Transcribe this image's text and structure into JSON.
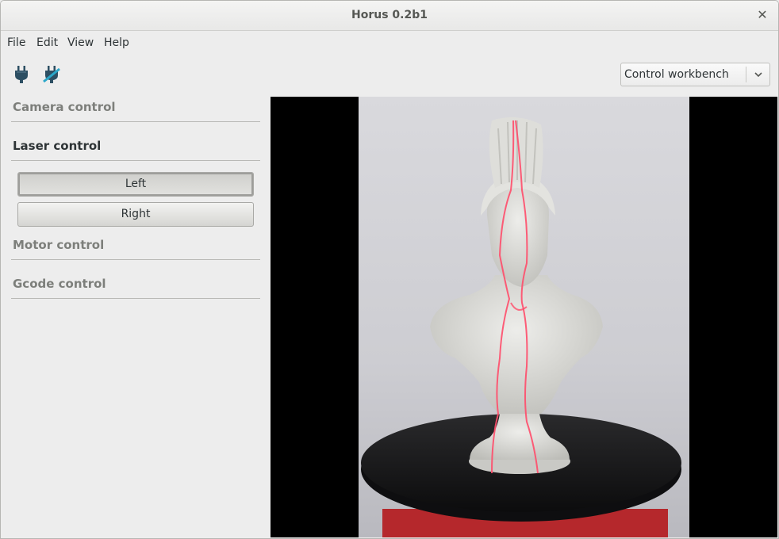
{
  "window": {
    "title": "Horus 0.2b1"
  },
  "menu": [
    "File",
    "Edit",
    "View",
    "Help"
  ],
  "toolbar": {
    "connect_icon": "plug-icon",
    "disconnect_icon": "plug-disconnect-icon"
  },
  "workbench": {
    "selected": "Control workbench"
  },
  "panels": {
    "camera": "Camera control",
    "laser": "Laser control",
    "motor": "Motor control",
    "gcode": "Gcode control"
  },
  "laser_buttons": {
    "left": "Left",
    "right": "Right"
  },
  "colors": {
    "laser_line": "#ff4d6a",
    "toolbar_icon": "#2d4f63",
    "disconnect_accent": "#2aa7c9"
  }
}
